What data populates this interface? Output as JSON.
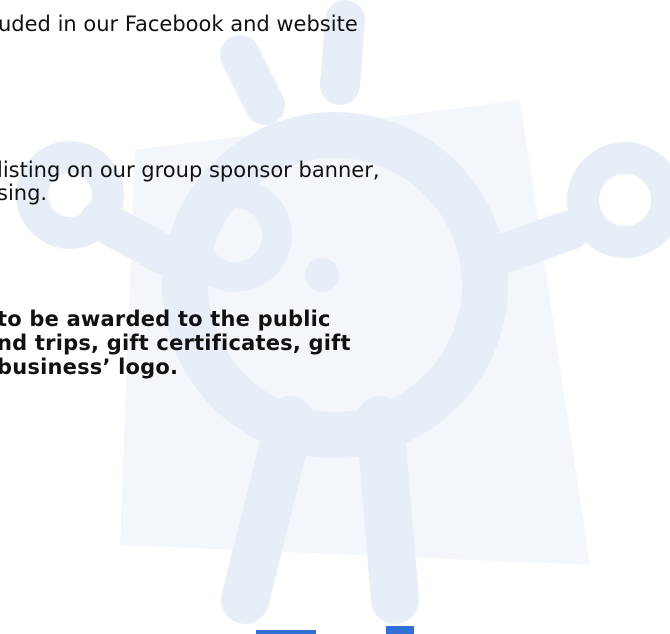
{
  "document": {
    "lines": [
      "uded in our Facebook and website",
      "listing on our group sponsor banner,",
      "sing.",
      "to be awarded to the public",
      "nd trips, gift certificates, gift",
      " business’ logo."
    ]
  },
  "watermark": {
    "icon": "smiley-mascot-watermark",
    "color": "#e8eef7"
  },
  "bottom_marks": {
    "color": "#2f6fd6"
  }
}
